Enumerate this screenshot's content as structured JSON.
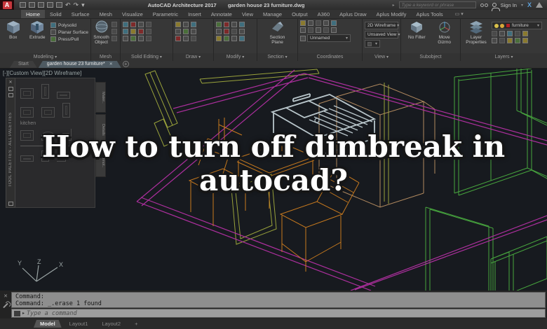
{
  "titlebar": {
    "app_title": "AutoCAD Architecture 2017",
    "doc_title": "garden house 23 furniture.dwg",
    "search_placeholder": "Type a keyword or phrase",
    "sign_in_label": "Sign In",
    "exchange_label": "X"
  },
  "ribbon": {
    "tabs": [
      {
        "label": "Home",
        "active": true
      },
      {
        "label": "Solid"
      },
      {
        "label": "Surface"
      },
      {
        "label": "Mesh"
      },
      {
        "label": "Visualize"
      },
      {
        "label": "Parametric"
      },
      {
        "label": "Insert"
      },
      {
        "label": "Annotate"
      },
      {
        "label": "View"
      },
      {
        "label": "Manage"
      },
      {
        "label": "Output"
      },
      {
        "label": "A360"
      },
      {
        "label": "Aplus Draw"
      },
      {
        "label": "Aplus Modify"
      },
      {
        "label": "Aplus Tools"
      }
    ],
    "modeling": {
      "label": "Modeling",
      "box": "Box",
      "extrude": "Extrude",
      "polysolid": "Polysolid",
      "planar_surface": "Planar Surface",
      "press_pull": "Press/Pull"
    },
    "mesh": {
      "label": "Mesh",
      "smooth_object": "Smooth Object"
    },
    "solid_editing": {
      "label": "Solid Editing"
    },
    "draw": {
      "label": "Draw"
    },
    "modify": {
      "label": "Modify"
    },
    "section": {
      "label": "Section",
      "section_plane": "Section Plane"
    },
    "coordinates": {
      "label": "Coordinates",
      "ucs_dropdown": "Unnamed"
    },
    "view": {
      "label": "View",
      "visual_style": "2D Wireframe",
      "named_view": "Unsaved View"
    },
    "subobject": {
      "label": "Subobject",
      "no_filter": "No Filter",
      "move_gizmo": "Move Gizmo"
    },
    "layers": {
      "label": "Layers",
      "layer_properties": "Layer Properties",
      "current_layer": "furniture"
    }
  },
  "file_tabs": {
    "start": "Start",
    "active_doc": "garden house 23 furniture*",
    "close_glyph": "✕",
    "new_tab_glyph": "+"
  },
  "viewport": {
    "corner_label": "[-][Custom View][2D Wireframe]"
  },
  "palette": {
    "title": "TOOL PALETTES - ALL PALETTES",
    "group_label": "kitchen",
    "side_tabs": [
      {
        "label": "Mater.."
      },
      {
        "label": "Details"
      },
      {
        "label": "Annot.."
      }
    ]
  },
  "overlay": {
    "line1": "How to turn off dimbreak in",
    "line2": "autocad?"
  },
  "ucs": {
    "x": "X",
    "y": "Y",
    "z": "Z"
  },
  "command": {
    "history": [
      {
        "text": "Command:"
      },
      {
        "text": "Command: _.erase 1 found"
      }
    ],
    "placeholder": "Type a command"
  },
  "layout_tabs": [
    {
      "label": "Model",
      "active": true
    },
    {
      "label": "Layout1"
    },
    {
      "label": "Layout2"
    },
    {
      "label": "+"
    }
  ],
  "colors": {
    "viewport_bg": "#171a1f",
    "magenta": "#ad2f9e",
    "green": "#47a53e",
    "orange": "#c87a1e",
    "tan": "#b28a5f",
    "olive": "#99a23b",
    "steel": "#b9c6cb",
    "layer_swatch": "#b01f24",
    "logo_red": "#c8373d"
  }
}
